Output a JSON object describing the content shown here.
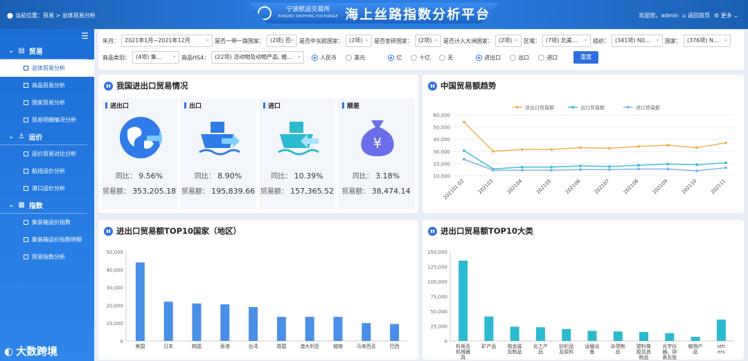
{
  "header": {
    "location_label": "当前位置：贸易 > 总体贸易分析",
    "org_name": "宁波航运交易所",
    "org_name_en": "NINGBO SHIPPING EXCHANGE",
    "title": "海上丝路指数分析平台",
    "welcome": "欢迎您，admin",
    "home": "返回首页",
    "more": "更多"
  },
  "sidebar": {
    "menu_icon": "☰",
    "sections": [
      {
        "label": "贸易",
        "items": [
          "总体贸易分析",
          "商品贸易分析",
          "国家贸易分析",
          "贸易明细情况分析"
        ]
      },
      {
        "label": "运价",
        "items": [
          "运价贸易对比分析",
          "航线运价分析",
          "港口运价分析"
        ]
      },
      {
        "label": "指数",
        "items": [
          "集装箱运价指数",
          "集装箱运价指数明细",
          "贸易指数分析"
        ]
      }
    ]
  },
  "filters": {
    "row1": [
      {
        "label": "年月：",
        "value": "2021年1月~2021年12月"
      },
      {
        "label": "是否一带一路国家：",
        "value": "(2项) 否"
      },
      {
        "label": "是否中东欧国家：",
        "value": "(2项)"
      },
      {
        "label": "是否金砖国家：",
        "value": "(2项)"
      },
      {
        "label": "是否计入大洲国家：",
        "value": "(2项)"
      },
      {
        "label": "区域：",
        "value": "(7项) 北美..."
      },
      {
        "label": "组织：",
        "value": "(341项) N0..."
      },
      {
        "label": "国家：",
        "value": "(376项) N..."
      }
    ],
    "row2_selects": [
      {
        "label": "商品类别：",
        "value": "(4项) 集..."
      },
      {
        "label": "商品HS4：",
        "value": "(22项) 活动物及动物产品, 植..."
      }
    ],
    "currency": [
      "人民币",
      "美元"
    ],
    "unit": [
      "亿",
      "十亿",
      "无"
    ],
    "direction": [
      "进出口",
      "出口",
      "进口"
    ],
    "reset": "重置"
  },
  "summary": {
    "title": "我国进出口贸易情况",
    "yoy_label": "同比：",
    "amount_label": "贸易额：",
    "cards": [
      {
        "name": "进出口",
        "yoy": "9.56%",
        "amount": "353,205.18",
        "icon": "globe-icon"
      },
      {
        "name": "出口",
        "yoy": "8.90%",
        "amount": "195,839.66",
        "icon": "ship-export-icon"
      },
      {
        "name": "进口",
        "yoy": "10.39%",
        "amount": "157,365.52",
        "icon": "ship-import-icon"
      },
      {
        "name": "顺差",
        "yoy": "3.18%",
        "amount": "38,474.14",
        "icon": "money-bag-icon"
      }
    ]
  },
  "colors": {
    "accent": "#2f6fe0",
    "line_total": "#f0b050",
    "line_export": "#3dc0d0",
    "line_import": "#7fb0ee",
    "bar": "#4a8fe8",
    "bar2": "#2bbad0"
  },
  "chart_data": [
    {
      "type": "line",
      "title": "中国贸易额趋势",
      "x": [
        "202101-02",
        "202103",
        "202104",
        "202105",
        "202106",
        "202107",
        "202108",
        "202109",
        "202110",
        "202111"
      ],
      "ylim": [
        10000,
        60000
      ],
      "yticks": [
        "60,000",
        "50,000",
        "40,000",
        "30,000",
        "20,000",
        "10,000"
      ],
      "legend": "top",
      "series": [
        {
          "name": "进出口贸易额",
          "values": [
            54000,
            30000,
            31500,
            31500,
            33000,
            32500,
            34000,
            35000,
            33000,
            37000
          ]
        },
        {
          "name": "出口贸易额",
          "values": [
            30500,
            15500,
            17000,
            17000,
            18000,
            17500,
            18500,
            19500,
            19000,
            20500
          ]
        },
        {
          "name": "进口贸易额",
          "values": [
            23500,
            14500,
            14500,
            14500,
            15000,
            15000,
            15500,
            15500,
            14000,
            16500
          ]
        }
      ]
    },
    {
      "type": "bar",
      "title": "进出口贸易额TOP10国家（地区）",
      "categories": [
        "美国",
        "日本",
        "韩国",
        "香港",
        "台湾",
        "德国",
        "澳大利亚",
        "越南",
        "马来西亚",
        "巴西"
      ],
      "values": [
        44000,
        22000,
        21000,
        20500,
        19000,
        13500,
        13500,
        13500,
        10000,
        9500
      ],
      "ylim": [
        0,
        50000
      ],
      "yticks": [
        "50,000",
        "40,000",
        "30,000",
        "20,000",
        "10,000",
        "0"
      ]
    },
    {
      "type": "bar",
      "title": "进出口贸易额TOP10大类",
      "categories": [
        "机电及机械器具",
        "矿产品",
        "贱金属及制品",
        "化工产品",
        "纺织品及原料",
        "运输设备",
        "杂项制品",
        "塑料橡胶及其制品",
        "光学仪器、钟表及医疗设备",
        "植物产品",
        "others"
      ],
      "values": [
        135000,
        41000,
        24000,
        23000,
        20000,
        17000,
        16000,
        15000,
        13000,
        7000,
        36000
      ],
      "ylim": [
        0,
        150000
      ],
      "yticks": [
        "150,000",
        "125,000",
        "100,000",
        "75,000",
        "50,000",
        "25,000",
        "0"
      ]
    }
  ],
  "watermark": "大数跨境"
}
